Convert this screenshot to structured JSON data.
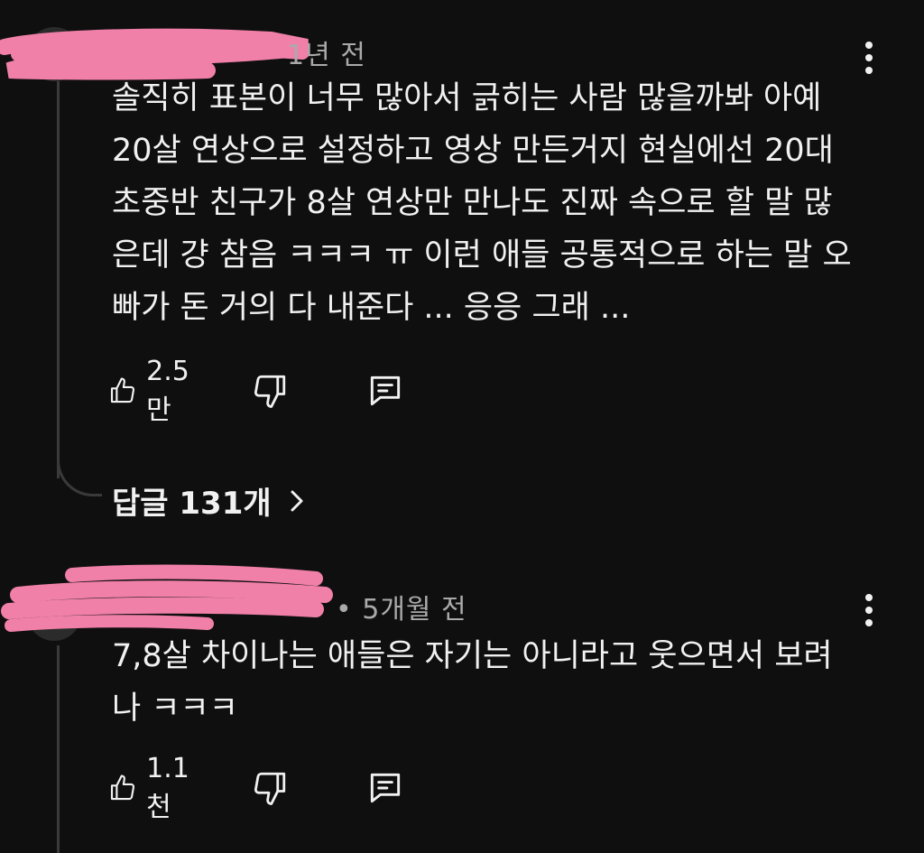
{
  "comments": [
    {
      "time": "1년 전",
      "text": "솔직히 표본이 너무 많아서 긁히는 사람 많을까봐 아예 20살 연상으로 설정하고 영상 만든거지 현실에선 20대 초중반 친구가 8살 연상만 만나도 진짜 속으로 할 말 많은데 걍 참음 ㅋㅋㅋ ㅠ 이런 애들 공통적으로 하는 말 오빠가 돈 거의 다 내준다 ... 응응 그래 ...",
      "likes": "2.5만",
      "replies_label": "답글 131개"
    },
    {
      "time": "• 5개월 전",
      "text": "7,8살 차이나는 애들은 자기는 아니라고 웃으면서 보려나 ㅋㅋㅋ",
      "likes": "1.1천"
    }
  ],
  "colors": {
    "background": "#0f0f0f",
    "text": "#f1f1f1",
    "meta": "#aaaaaa",
    "redaction": "#f080a8"
  },
  "icons": [
    "thumbs-up-icon",
    "thumbs-down-icon",
    "reply-icon",
    "more-vert-icon",
    "chevron-right-icon"
  ]
}
